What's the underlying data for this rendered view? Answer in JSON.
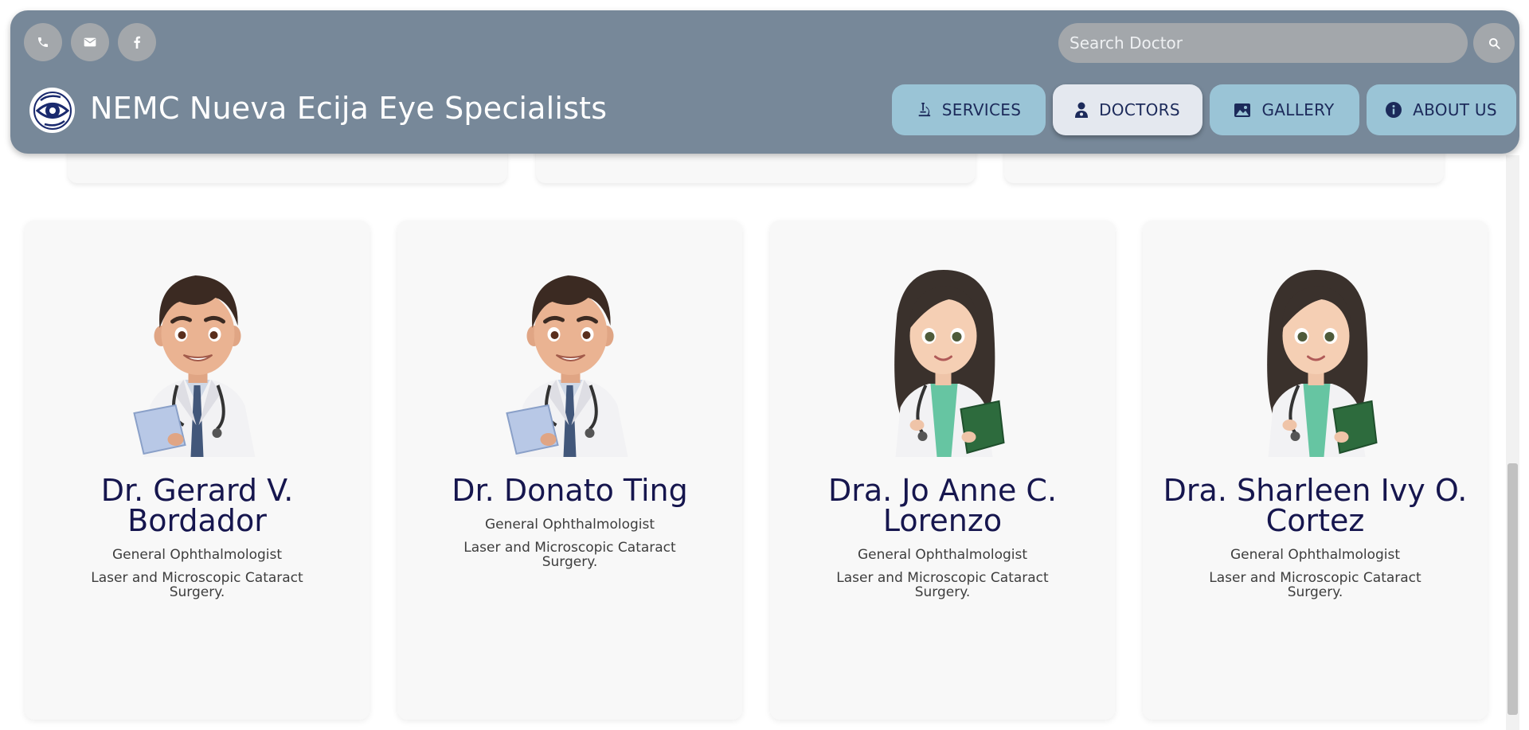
{
  "header": {
    "title": "NEMC Nueva Ecija Eye Specialists",
    "search": {
      "placeholder": "Search Doctor"
    },
    "nav": [
      {
        "label": "SERVICES",
        "icon": "microscope-icon"
      },
      {
        "label": "DOCTORS",
        "icon": "doctor-icon"
      },
      {
        "label": "GALLERY",
        "icon": "image-icon"
      },
      {
        "label": "ABOUT US",
        "icon": "info-icon"
      }
    ],
    "active_nav": "DOCTORS",
    "social": [
      "phone-icon",
      "email-icon",
      "facebook-icon"
    ]
  },
  "doctors": [
    {
      "name": "Dr. Gerard V. Bordador",
      "specialty": "General Ophthalmologist",
      "description": "Laser and Microscopic Cataract Surgery.",
      "avatar": "male-doctor-avatar"
    },
    {
      "name": "Dr. Donato Ting",
      "specialty": "General Ophthalmologist",
      "description": "Laser and Microscopic Cataract Surgery.",
      "avatar": "male-doctor-avatar"
    },
    {
      "name": "Dra. Jo Anne C. Lorenzo",
      "specialty": "General Ophthalmologist",
      "description": "Laser and Microscopic Cataract Surgery.",
      "avatar": "female-doctor-avatar"
    },
    {
      "name": "Dra. Sharleen Ivy O. Cortez",
      "specialty": "General Ophthalmologist",
      "description": "Laser and Microscopic Cataract Surgery.",
      "avatar": "female-doctor-avatar"
    }
  ],
  "colors": {
    "header_bg": "#778899",
    "nav_bg": "#9ac4d6",
    "nav_active_bg": "#e4e8ef",
    "name_color": "#16164e"
  }
}
